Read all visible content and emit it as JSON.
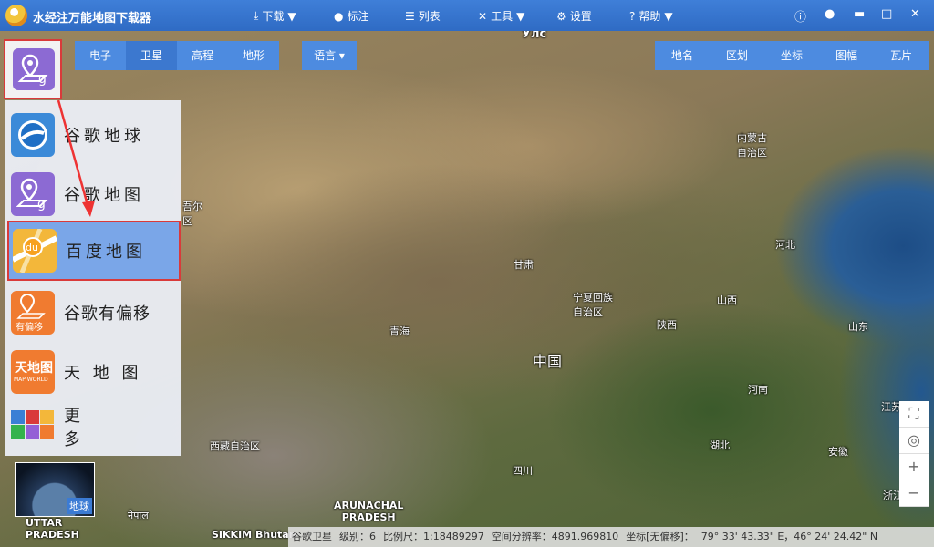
{
  "app": {
    "title": "水经注万能地图下载器"
  },
  "menu": [
    {
      "icon": "download-icon",
      "label": "下载"
    },
    {
      "icon": "pin-icon",
      "label": "标注"
    },
    {
      "icon": "list-icon",
      "label": "列表"
    },
    {
      "icon": "tools-icon",
      "label": "工具"
    },
    {
      "icon": "gear-icon",
      "label": "设置"
    },
    {
      "icon": "help-icon",
      "label": "帮助"
    }
  ],
  "view_tabs": [
    "电子",
    "卫星",
    "高程",
    "地形"
  ],
  "active_view": "卫星",
  "language": "语言",
  "layer_tabs": [
    "地名",
    "区划",
    "坐标",
    "图幅",
    "瓦片"
  ],
  "sources": [
    {
      "label": "谷歌地球",
      "icon": "google-earth-icon"
    },
    {
      "label": "谷歌地图",
      "icon": "google-maps-icon"
    },
    {
      "label": "百度地图",
      "icon": "baidu-maps-icon",
      "tile_text": "du"
    },
    {
      "label": "谷歌有偏移",
      "icon": "google-offset-icon",
      "tile_text": "有偏移"
    },
    {
      "label": "天 地 图",
      "icon": "tianditu-icon",
      "tile_text": "MAP WORLD"
    },
    {
      "label": "更 多",
      "icon": "more-grid-icon"
    }
  ],
  "places": {
    "ulc": "Улс",
    "inner_mongolia": "内蒙古\n自治区",
    "hebei": "河北",
    "gansu": "甘肃",
    "ningxia": "宁夏回族\n自治区",
    "shanxi": "山西",
    "qinghai": "青海",
    "shaanxi": "陕西",
    "shandong": "山东",
    "china": "中国",
    "henan": "河南",
    "jiangsu": "江苏",
    "tibet": "西藏自治区",
    "hubei": "湖北",
    "anhui": "安徽",
    "sichuan": "四川",
    "zhejiang": "浙江",
    "arunachal": "ARUNACHAL\nPRADESH",
    "nepal": "नेपाल",
    "uttar": "UTTAR\nPRADESH",
    "sikkim": "SIKKIM",
    "bhutan": "Bhutan",
    "xinjiang_frag": "吾尔\n区"
  },
  "globe": {
    "label": "地球"
  },
  "status": {
    "source": "谷歌卫星",
    "level": "级别：6",
    "scale": "比例尺：1:18489297",
    "resolution": "空间分辨率：4891.969810",
    "coord_label": "坐标[无偏移]：",
    "coord_value": "79° 33' 43.33\" E，46° 24' 24.42\" N"
  }
}
